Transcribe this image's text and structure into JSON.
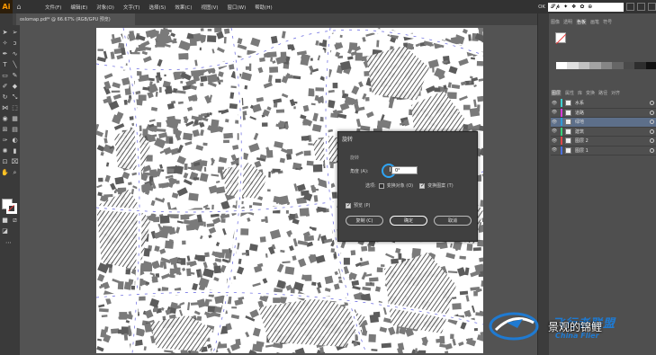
{
  "app": {
    "logo": "Ai",
    "home_icon": "home-icon"
  },
  "menu": [
    "文件(F)",
    "编辑(E)",
    "对象(O)",
    "文字(T)",
    "选择(S)",
    "效果(C)",
    "视图(V)",
    "窗口(W)",
    "帮助(H)"
  ],
  "menubar_right": {
    "badge": "OK",
    "box_text": "𝓢𝓹 ✦ ❖ ✿ ⊕"
  },
  "document": {
    "tab_title": "oslomap.pdf* @ 66.67% (RGB/GPU 预览)"
  },
  "dialog": {
    "title": "旋转",
    "section_label": "旋转",
    "angle_label": "角度 (A):",
    "angle_value": "0°",
    "options_label": "选项:",
    "transform_objects_label": "变换对象 (O)",
    "transform_patterns_label": "变换图案 (T)",
    "preview_label": "预览 (P)",
    "copy_button": "复制 (C)",
    "ok_button": "确定",
    "cancel_button": "取消"
  },
  "right_panel": {
    "color_tabs": [
      "图像",
      "透明",
      "色板",
      "画笔",
      "符号"
    ],
    "layers_tabs": [
      "图层",
      "属性",
      "库",
      "变换",
      "路径",
      "对齐"
    ],
    "layers": [
      {
        "name": "水系",
        "color": "#3fd1d1",
        "selected": false
      },
      {
        "name": "道路",
        "color": "#d83ad8",
        "selected": false
      },
      {
        "name": "绿地",
        "color": "#2f9bd8",
        "selected": true
      },
      {
        "name": "建筑",
        "color": "#3bd17a",
        "selected": false
      },
      {
        "name": "图层 2",
        "color": "#e04848",
        "selected": false
      },
      {
        "name": "图层 1",
        "color": "#4a6fe0",
        "selected": false
      }
    ]
  },
  "watermark": {
    "main": "飞行者联盟",
    "caption": "景观的锦鲤",
    "sub": "China Flier"
  }
}
